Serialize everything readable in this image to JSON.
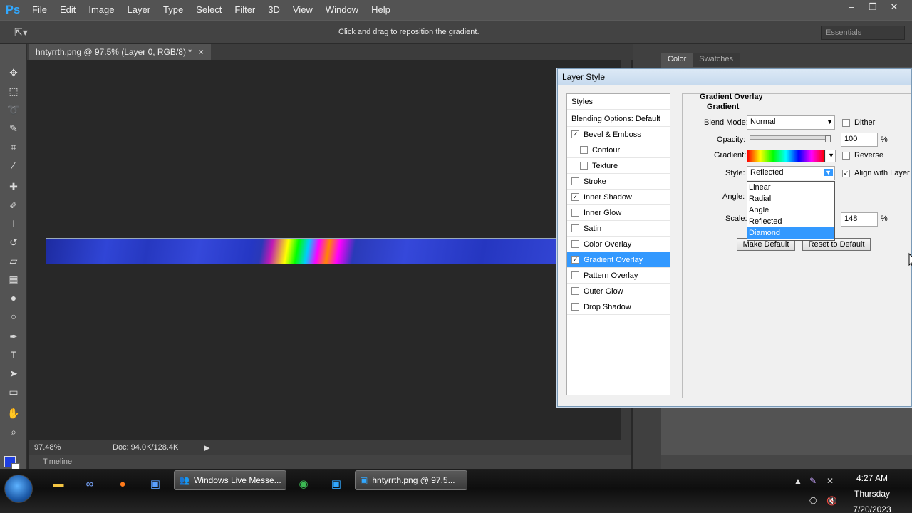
{
  "app": {
    "logo": "Ps"
  },
  "menu": [
    "File",
    "Edit",
    "Image",
    "Layer",
    "Type",
    "Select",
    "Filter",
    "3D",
    "View",
    "Window",
    "Help"
  ],
  "window_controls": {
    "minimize": "–",
    "restore": "❐",
    "close": "✕"
  },
  "options_bar": {
    "hint": "Click and drag to reposition the gradient.",
    "workspace": "Essentials"
  },
  "document": {
    "tab_title": "hntyrrth.png @ 97.5% (Layer 0, RGB/8) *",
    "tab_close": "×"
  },
  "status": {
    "zoom": "97.48%",
    "doc_info": "Doc: 94.0K/128.4K",
    "timeline_label": "Timeline"
  },
  "panels": {
    "tabs": [
      "Color",
      "Swatches"
    ]
  },
  "dialog": {
    "title": "Layer Style",
    "styles_header": "Styles",
    "blending_options": "Blending Options: Default",
    "effects": [
      {
        "label": "Bevel & Emboss",
        "checked": true,
        "indent": false,
        "selected": false
      },
      {
        "label": "Contour",
        "checked": false,
        "indent": true,
        "selected": false
      },
      {
        "label": "Texture",
        "checked": false,
        "indent": true,
        "selected": false
      },
      {
        "label": "Stroke",
        "checked": false,
        "indent": false,
        "selected": false
      },
      {
        "label": "Inner Shadow",
        "checked": true,
        "indent": false,
        "selected": false
      },
      {
        "label": "Inner Glow",
        "checked": false,
        "indent": false,
        "selected": false
      },
      {
        "label": "Satin",
        "checked": false,
        "indent": false,
        "selected": false
      },
      {
        "label": "Color Overlay",
        "checked": false,
        "indent": false,
        "selected": false
      },
      {
        "label": "Gradient Overlay",
        "checked": true,
        "indent": false,
        "selected": true
      },
      {
        "label": "Pattern Overlay",
        "checked": false,
        "indent": false,
        "selected": false
      },
      {
        "label": "Outer Glow",
        "checked": false,
        "indent": false,
        "selected": false
      },
      {
        "label": "Drop Shadow",
        "checked": false,
        "indent": false,
        "selected": false
      }
    ],
    "section_title": "Gradient Overlay",
    "group_title": "Gradient",
    "blend_mode_label": "Blend Mode:",
    "blend_mode_value": "Normal",
    "dither_label": "Dither",
    "opacity_label": "Opacity:",
    "opacity_value": "100",
    "percent": "%",
    "gradient_label": "Gradient:",
    "reverse_label": "Reverse",
    "style_label": "Style:",
    "style_value": "Reflected",
    "align_label": "Align with Layer",
    "angle_label": "Angle:",
    "scale_label": "Scale:",
    "scale_value": "148",
    "style_options": [
      "Linear",
      "Radial",
      "Angle",
      "Reflected",
      "Diamond"
    ],
    "highlighted_option": "Diamond",
    "make_default_label": "Make Default",
    "reset_default_label": "Reset to Default"
  },
  "taskbar": {
    "tasks": [
      "Windows Live Messe...",
      "hntyrrth.png @ 97.5..."
    ],
    "clock_time": "4:27 AM",
    "clock_day": "Thursday",
    "clock_date": "7/20/2023"
  },
  "colors": {
    "foreground": "#1f3fe0",
    "background": "#ffffff",
    "selection": "#3399ff"
  }
}
